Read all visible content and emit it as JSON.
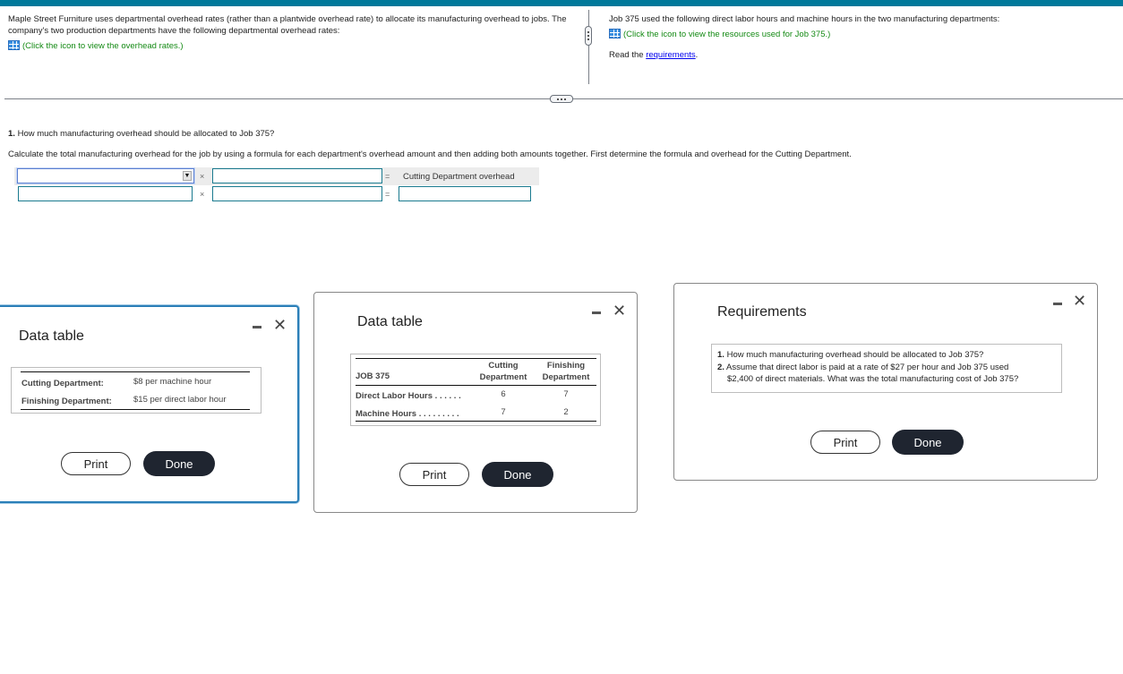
{
  "colors": {
    "topbar": "#00799a",
    "link_green": "#148a14",
    "done_button": "#1f2530"
  },
  "left_panel": {
    "intro": "Maple Street Furniture uses departmental overhead rates (rather than a plantwide overhead rate) to allocate its manufacturing overhead to jobs. The company's two production departments have the following departmental overhead rates:",
    "icon_link": "(Click the icon to view the overhead rates.)"
  },
  "right_panel": {
    "intro": "Job 375 used the following direct labor hours and machine hours in the two manufacturing departments:",
    "icon_link": "(Click the icon to view the resources used for Job 375.)",
    "read_prefix": "Read the ",
    "read_link": "requirements",
    "read_suffix": "."
  },
  "question": {
    "title_num": "1.",
    "title": " How much manufacturing overhead should be allocated to Job 375?",
    "instruction": "Calculate the total manufacturing overhead for the job by using a formula for each department's overhead amount and then adding both amounts together. First determine the formula and overhead for the Cutting Department.",
    "row1": {
      "select_value": "",
      "input_value": "",
      "operator": "×",
      "equals": "=",
      "result_label": "Cutting Department overhead"
    },
    "row2": {
      "input1_value": "",
      "input2_value": "",
      "result_value": "",
      "operator": "×",
      "equals": "="
    }
  },
  "dialog_rates": {
    "title": "Data table",
    "rows": [
      {
        "label": "Cutting Department:",
        "value": "$8 per machine hour"
      },
      {
        "label": "Finishing Department:",
        "value": "$15 per direct labor hour"
      }
    ],
    "print": "Print",
    "done": "Done"
  },
  "dialog_resources": {
    "title": "Data table",
    "header": {
      "job": "JOB 375",
      "col1_line1": "Cutting",
      "col1_line2": "Department",
      "col2_line1": "Finishing",
      "col2_line2": "Department"
    },
    "rows": [
      {
        "label": "Direct Labor Hours . . . . . .",
        "cutting": "6",
        "finishing": "7"
      },
      {
        "label": "Machine Hours  . . . . . . . . .",
        "cutting": "7",
        "finishing": "2"
      }
    ],
    "print": "Print",
    "done": "Done"
  },
  "dialog_requirements": {
    "title": "Requirements",
    "items": [
      {
        "num": "1.",
        "text": " How much manufacturing overhead should be allocated to Job 375?"
      },
      {
        "num": "2.",
        "text": " Assume that direct labor is paid at a rate of $27 per hour and Job 375 used",
        "text2": "$2,400 of direct materials. What was the total manufacturing cost of Job 375?"
      }
    ],
    "print": "Print",
    "done": "Done"
  }
}
